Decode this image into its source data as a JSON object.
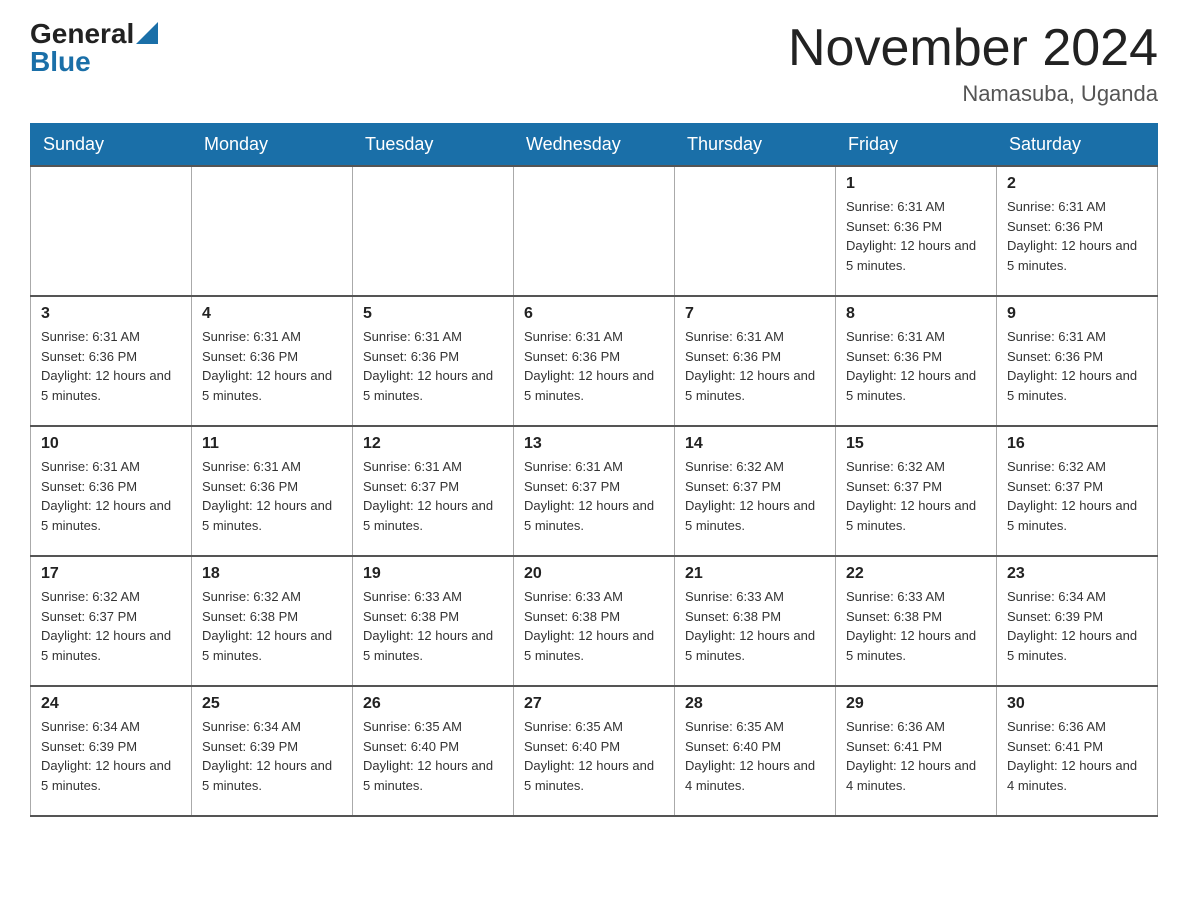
{
  "header": {
    "logo_general": "General",
    "logo_blue": "Blue",
    "month_title": "November 2024",
    "location": "Namasuba, Uganda"
  },
  "days_of_week": [
    "Sunday",
    "Monday",
    "Tuesday",
    "Wednesday",
    "Thursday",
    "Friday",
    "Saturday"
  ],
  "weeks": [
    {
      "days": [
        {
          "number": "",
          "info": ""
        },
        {
          "number": "",
          "info": ""
        },
        {
          "number": "",
          "info": ""
        },
        {
          "number": "",
          "info": ""
        },
        {
          "number": "",
          "info": ""
        },
        {
          "number": "1",
          "info": "Sunrise: 6:31 AM\nSunset: 6:36 PM\nDaylight: 12 hours and 5 minutes."
        },
        {
          "number": "2",
          "info": "Sunrise: 6:31 AM\nSunset: 6:36 PM\nDaylight: 12 hours and 5 minutes."
        }
      ]
    },
    {
      "days": [
        {
          "number": "3",
          "info": "Sunrise: 6:31 AM\nSunset: 6:36 PM\nDaylight: 12 hours and 5 minutes."
        },
        {
          "number": "4",
          "info": "Sunrise: 6:31 AM\nSunset: 6:36 PM\nDaylight: 12 hours and 5 minutes."
        },
        {
          "number": "5",
          "info": "Sunrise: 6:31 AM\nSunset: 6:36 PM\nDaylight: 12 hours and 5 minutes."
        },
        {
          "number": "6",
          "info": "Sunrise: 6:31 AM\nSunset: 6:36 PM\nDaylight: 12 hours and 5 minutes."
        },
        {
          "number": "7",
          "info": "Sunrise: 6:31 AM\nSunset: 6:36 PM\nDaylight: 12 hours and 5 minutes."
        },
        {
          "number": "8",
          "info": "Sunrise: 6:31 AM\nSunset: 6:36 PM\nDaylight: 12 hours and 5 minutes."
        },
        {
          "number": "9",
          "info": "Sunrise: 6:31 AM\nSunset: 6:36 PM\nDaylight: 12 hours and 5 minutes."
        }
      ]
    },
    {
      "days": [
        {
          "number": "10",
          "info": "Sunrise: 6:31 AM\nSunset: 6:36 PM\nDaylight: 12 hours and 5 minutes."
        },
        {
          "number": "11",
          "info": "Sunrise: 6:31 AM\nSunset: 6:36 PM\nDaylight: 12 hours and 5 minutes."
        },
        {
          "number": "12",
          "info": "Sunrise: 6:31 AM\nSunset: 6:37 PM\nDaylight: 12 hours and 5 minutes."
        },
        {
          "number": "13",
          "info": "Sunrise: 6:31 AM\nSunset: 6:37 PM\nDaylight: 12 hours and 5 minutes."
        },
        {
          "number": "14",
          "info": "Sunrise: 6:32 AM\nSunset: 6:37 PM\nDaylight: 12 hours and 5 minutes."
        },
        {
          "number": "15",
          "info": "Sunrise: 6:32 AM\nSunset: 6:37 PM\nDaylight: 12 hours and 5 minutes."
        },
        {
          "number": "16",
          "info": "Sunrise: 6:32 AM\nSunset: 6:37 PM\nDaylight: 12 hours and 5 minutes."
        }
      ]
    },
    {
      "days": [
        {
          "number": "17",
          "info": "Sunrise: 6:32 AM\nSunset: 6:37 PM\nDaylight: 12 hours and 5 minutes."
        },
        {
          "number": "18",
          "info": "Sunrise: 6:32 AM\nSunset: 6:38 PM\nDaylight: 12 hours and 5 minutes."
        },
        {
          "number": "19",
          "info": "Sunrise: 6:33 AM\nSunset: 6:38 PM\nDaylight: 12 hours and 5 minutes."
        },
        {
          "number": "20",
          "info": "Sunrise: 6:33 AM\nSunset: 6:38 PM\nDaylight: 12 hours and 5 minutes."
        },
        {
          "number": "21",
          "info": "Sunrise: 6:33 AM\nSunset: 6:38 PM\nDaylight: 12 hours and 5 minutes."
        },
        {
          "number": "22",
          "info": "Sunrise: 6:33 AM\nSunset: 6:38 PM\nDaylight: 12 hours and 5 minutes."
        },
        {
          "number": "23",
          "info": "Sunrise: 6:34 AM\nSunset: 6:39 PM\nDaylight: 12 hours and 5 minutes."
        }
      ]
    },
    {
      "days": [
        {
          "number": "24",
          "info": "Sunrise: 6:34 AM\nSunset: 6:39 PM\nDaylight: 12 hours and 5 minutes."
        },
        {
          "number": "25",
          "info": "Sunrise: 6:34 AM\nSunset: 6:39 PM\nDaylight: 12 hours and 5 minutes."
        },
        {
          "number": "26",
          "info": "Sunrise: 6:35 AM\nSunset: 6:40 PM\nDaylight: 12 hours and 5 minutes."
        },
        {
          "number": "27",
          "info": "Sunrise: 6:35 AM\nSunset: 6:40 PM\nDaylight: 12 hours and 5 minutes."
        },
        {
          "number": "28",
          "info": "Sunrise: 6:35 AM\nSunset: 6:40 PM\nDaylight: 12 hours and 4 minutes."
        },
        {
          "number": "29",
          "info": "Sunrise: 6:36 AM\nSunset: 6:41 PM\nDaylight: 12 hours and 4 minutes."
        },
        {
          "number": "30",
          "info": "Sunrise: 6:36 AM\nSunset: 6:41 PM\nDaylight: 12 hours and 4 minutes."
        }
      ]
    }
  ]
}
